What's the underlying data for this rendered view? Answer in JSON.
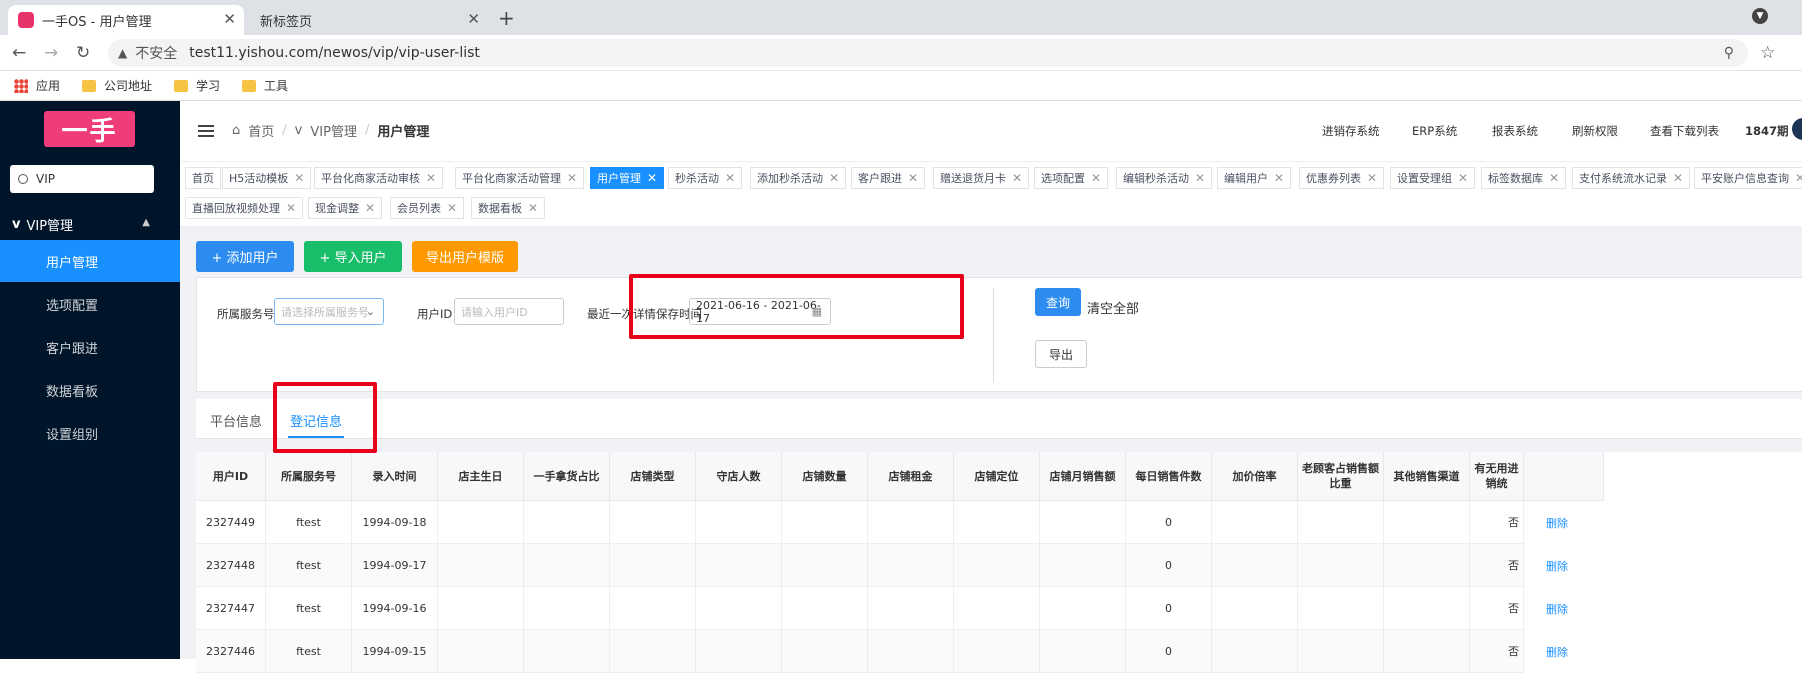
{
  "browser": {
    "tabs": [
      {
        "title": "一手OS - 用户管理"
      },
      {
        "title": "新标签页"
      }
    ],
    "insecure_label": "不安全",
    "url": "test11.yishou.com/newos/vip/vip-user-list",
    "bookmarks": [
      "应用",
      "公司地址",
      "学习",
      "工具"
    ]
  },
  "sidebar": {
    "logo": "一手",
    "search_value": "VIP",
    "group": "VIP管理",
    "items": [
      {
        "label": "用户管理",
        "active": true
      },
      {
        "label": "选项配置"
      },
      {
        "label": "客户跟进"
      },
      {
        "label": "数据看板"
      },
      {
        "label": "设置组别"
      }
    ]
  },
  "header": {
    "breadcrumb": [
      "首页",
      "VIP管理",
      "用户管理"
    ],
    "nav": [
      "进销存系统",
      "ERP系统",
      "报表系统",
      "刷新权限",
      "查看下载列表",
      "1847期"
    ]
  },
  "tags": [
    "首页",
    "H5活动模板",
    "平台化商家活动审核",
    "平台化商家活动管理",
    "用户管理",
    "秒杀活动",
    "添加秒杀活动",
    "客户跟进",
    "赠送退货月卡",
    "选项配置",
    "编辑秒杀活动",
    "编辑用户",
    "优惠券列表",
    "设置受理组",
    "标签数据库",
    "支付系统流水记录",
    "平安账户信息查询",
    "直播回放视频处理",
    "现金调整",
    "会员列表",
    "数据看板"
  ],
  "actions": {
    "add_user": "+ 添加用户",
    "import_user": "+ 导入用户",
    "export_template": "导出用户模版"
  },
  "filter": {
    "service_label": "所属服务号",
    "service_placeholder": "请选择所属服务号",
    "uid_label": "用户ID",
    "uid_placeholder": "请输入用户ID",
    "date_label": "最近一次详情保存时间",
    "date_value": "2021-06-16 - 2021-06-17",
    "query": "查询",
    "clear": "清空全部",
    "export": "导出"
  },
  "page_tabs": [
    "平台信息",
    "登记信息"
  ],
  "table": {
    "columns": [
      "用户ID",
      "所属服务号",
      "录入时间",
      "店主生日",
      "一手拿货占比",
      "店铺类型",
      "守店人数",
      "店铺数量",
      "店铺租金",
      "店铺定位",
      "店铺月销售额",
      "每日销售件数",
      "加价倍率",
      "老顾客占销售额比重",
      "其他销售渠道",
      "有无用进销统"
    ],
    "rows": [
      {
        "id": "2327449",
        "service": "ftest",
        "date": "1994-09-18",
        "daily": "0",
        "flag": "否",
        "op": "删除"
      },
      {
        "id": "2327448",
        "service": "ftest",
        "date": "1994-09-17",
        "daily": "0",
        "flag": "否",
        "op": "删除"
      },
      {
        "id": "2327447",
        "service": "ftest",
        "date": "1994-09-16",
        "daily": "0",
        "flag": "否",
        "op": "删除"
      },
      {
        "id": "2327446",
        "service": "ftest",
        "date": "1994-09-15",
        "daily": "0",
        "flag": "否",
        "op": "删除"
      }
    ]
  },
  "colors": {
    "primary": "#1890ff",
    "green": "#19be6b",
    "orange": "#ff9900",
    "sidebar": "#001529",
    "highlight": "#e8001b"
  }
}
